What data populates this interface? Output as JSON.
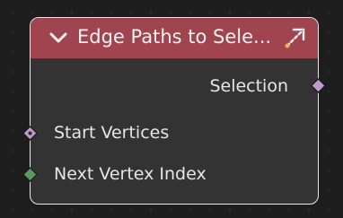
{
  "node": {
    "title": "Edge Paths to Sele...",
    "collapse_icon": "chevron-down-icon",
    "edit_icon": "link-arrow-icon",
    "header_color": "#a0454f",
    "body_color": "#333333",
    "border_color": "#e9e9e9"
  },
  "outputs": [
    {
      "label": "Selection",
      "socket_icon": "diamond-socket-icon",
      "color": "#c597cf"
    }
  ],
  "inputs": [
    {
      "label": "Start Vertices",
      "socket_icon": "diamond-dot-socket-icon",
      "color": "#c597cf"
    },
    {
      "label": "Next Vertex Index",
      "socket_icon": "diamond-socket-icon",
      "color": "#5a9a5e"
    }
  ]
}
